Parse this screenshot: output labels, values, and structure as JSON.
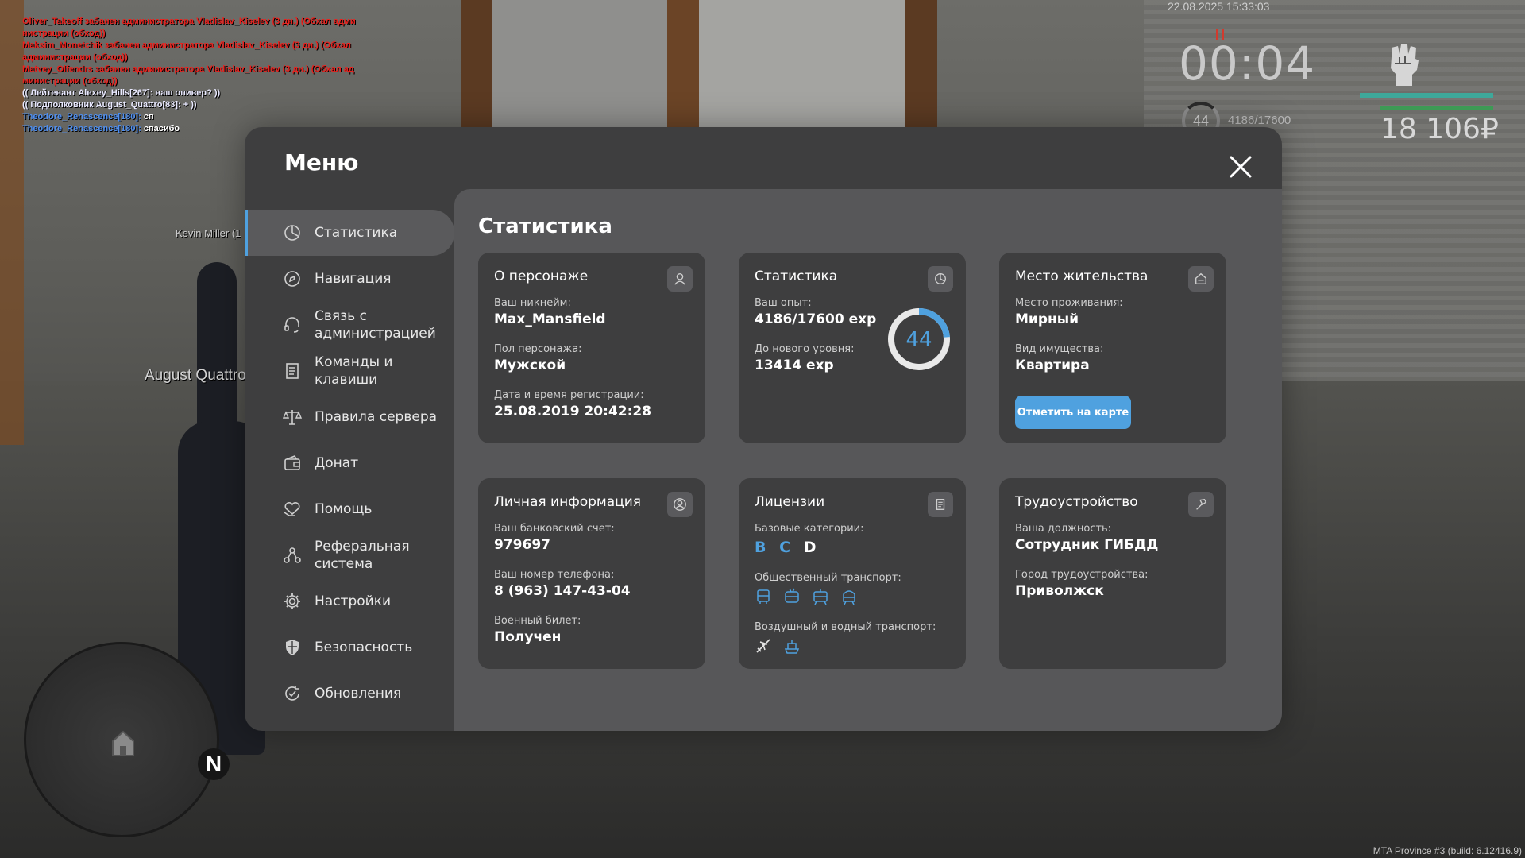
{
  "chat": [
    {
      "text": "Oliver_Takeoff забанен администратора Vladislav_Kiselev (3 дн.) (Обхал адми",
      "color": "#e8231f"
    },
    {
      "text": "нистрации (обход))",
      "color": "#e8231f"
    },
    {
      "text": "Maksim_Monetchik забанен администратора Vladislav_Kiselev (3 дн.) (Обхал",
      "color": "#e8231f"
    },
    {
      "text": " администрации (обход))",
      "color": "#e8231f"
    },
    {
      "text": "Matvey_Olfendrs забанен администратора Vladislav_Kiselev (3 дн.) (Обхал ад",
      "color": "#e8231f"
    },
    {
      "text": "министрации (обход))",
      "color": "#e8231f"
    },
    {
      "text": "(( Лейтенант Alexey_Hills[267]: наш опивер? ))",
      "color": "#e9e9ff"
    },
    {
      "text": "(( Подполковник August_Quattro[83]: + ))",
      "color": "#e9e9ff"
    }
  ],
  "chat_msgs": [
    {
      "name": "Theodore_Renascence[180]:",
      "text": "сп"
    },
    {
      "name": "Theodore_Renascence[180]:",
      "text": "спасибо"
    }
  ],
  "nametags": {
    "kevin": "Kevin Miller (1",
    "august": "August Quattro"
  },
  "hud": {
    "datetime": "22.08.2025 15:33:03",
    "timer": "00:04",
    "level": "44",
    "exp": "4186/17600",
    "money": "18 106₽"
  },
  "build": "MTA Province #3 (build: 6.12416.9)",
  "minimap": {
    "north": "N"
  },
  "menu": {
    "title": "Меню",
    "sidebar": [
      {
        "label": "Статистика",
        "icon": "chart-pie-icon",
        "active": true
      },
      {
        "label": "Навигация",
        "icon": "compass-icon"
      },
      {
        "label": "Связь с администрацией",
        "icon": "headset-icon"
      },
      {
        "label": "Команды и клавиши",
        "icon": "document-icon"
      },
      {
        "label": "Правила сервера",
        "icon": "scales-icon"
      },
      {
        "label": "Донат",
        "icon": "wallet-icon"
      },
      {
        "label": "Помощь",
        "icon": "heart-hand-icon"
      },
      {
        "label": "Реферальная система",
        "icon": "referral-icon"
      },
      {
        "label": "Настройки",
        "icon": "gear-icon"
      },
      {
        "label": "Безопасность",
        "icon": "shield-icon"
      },
      {
        "label": "Обновления",
        "icon": "update-icon"
      }
    ],
    "content_title": "Статистика",
    "cards": {
      "character": {
        "title": "О персонаже",
        "nickname_label": "Ваш никнейм:",
        "nickname": "Max_Mansfield",
        "gender_label": "Пол персонажа:",
        "gender": "Мужской",
        "reg_label": "Дата и время регистрации:",
        "reg": "25.08.2019 20:42:28"
      },
      "stats": {
        "title": "Статистика",
        "exp_label": "Ваш опыт:",
        "exp": "4186/17600 exp",
        "next_label": "До нового уровня:",
        "next": "13414 exp",
        "level": "44",
        "progress": 0.2378
      },
      "residence": {
        "title": "Место жительства",
        "place_label": "Место проживания:",
        "place": "Мирный",
        "property_label": "Вид имущества:",
        "property": "Квартира",
        "button": "Отметить на карте"
      },
      "personal": {
        "title": "Личная информация",
        "bank_label": "Ваш банковский счет:",
        "bank": "979697",
        "phone_label": "Ваш номер телефона:",
        "phone": "8 (963) 147-43-04",
        "military_label": "Военный билет:",
        "military": "Получен"
      },
      "licenses": {
        "title": "Лицензии",
        "base_label": "Базовые категории:",
        "categories": [
          {
            "letter": "B",
            "color": "#4fa1df"
          },
          {
            "letter": "C",
            "color": "#4fa1df"
          },
          {
            "letter": "D",
            "color": "#ffffff"
          }
        ],
        "public_label": "Общественный транспорт:",
        "public_icons": [
          "bus-icon",
          "trolleybus-icon",
          "tram-icon",
          "metro-icon"
        ],
        "airwater_label": "Воздушный и водный транспорт:",
        "airwater_icons": [
          "plane-icon",
          "boat-icon"
        ]
      },
      "employment": {
        "title": "Трудоустройство",
        "position_label": "Ваша должность:",
        "position": "Сотрудник ГИБДД",
        "city_label": "Город трудоустройства:",
        "city": "Приволжск"
      }
    }
  },
  "colors": {
    "accent": "#4fa1df",
    "panel": "#3e3e3f",
    "content": "#575759",
    "card": "#3e3e3f"
  }
}
